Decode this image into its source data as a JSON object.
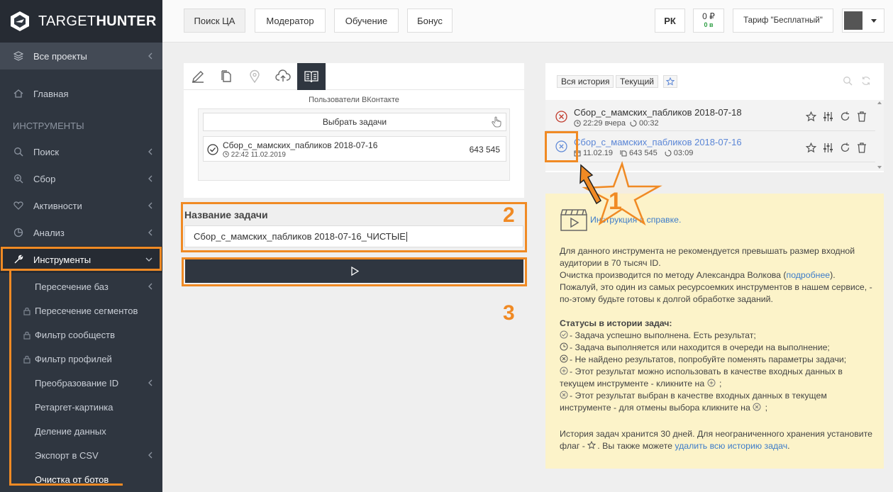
{
  "brand": {
    "name_light": "TARGET",
    "name_bold": "HUNTER"
  },
  "sidebar": {
    "all_projects": "Все проекты",
    "home": "Главная",
    "section_tools": "ИНСТРУМЕНТЫ",
    "items": [
      {
        "label": "Поиск"
      },
      {
        "label": "Сбор"
      },
      {
        "label": "Активности"
      },
      {
        "label": "Анализ"
      },
      {
        "label": "Инструменты"
      }
    ],
    "sub_items": [
      {
        "label": "Пересечение баз"
      },
      {
        "label": "Пересечение сегментов"
      },
      {
        "label": "Фильтр сообществ"
      },
      {
        "label": "Фильтр профилей"
      },
      {
        "label": "Преобразование ID"
      },
      {
        "label": "Ретаргет-картинка"
      },
      {
        "label": "Деление данных"
      },
      {
        "label": "Экспорт в CSV"
      },
      {
        "label": "Очистка от ботов"
      }
    ]
  },
  "topbar": {
    "buttons": [
      "Поиск ЦА",
      "Модератор",
      "Обучение",
      "Бонус"
    ],
    "rk": "РК",
    "balance": "0 ₽",
    "balance_sub": "0 в",
    "tariff": "Тариф \"Бесплатный\""
  },
  "tool": {
    "source_label": "Пользователи ВКонтакте",
    "choose_tasks": "Выбрать задачи",
    "selected_task": {
      "name": "Сбор_с_мамских_пабликов 2018-07-16",
      "time": "22:42 11.02.2019",
      "count": "643 545"
    },
    "name_label": "Название задачи",
    "name_value": "Сбор_с_мамских_пабликов 2018-07-16_ЧИСТЫЕ"
  },
  "history": {
    "all_history": "Вся история",
    "current": "Текущий",
    "rows": [
      {
        "name": "Сбор_с_мамских_пабликов 2018-07-18",
        "time": "22:29 вчера",
        "duration": "00:32"
      },
      {
        "name": "Сбор_с_мамских_пабликов 2018-07-16",
        "date": "11.02.19",
        "count": "643 545",
        "duration": "03:09"
      }
    ]
  },
  "help": {
    "instruction_link": "Инструкция в справке.",
    "p1a": "Для данного инструмента не рекомендуется превышать размер входной аудитории в 70 тысяч ID.",
    "p1b_pre": "Очистка производится по методу Александра Волкова (",
    "p1b_link": "подробнее",
    "p1b_post": ").",
    "p1c": "Пожалуй, это один из самых ресурсоемких инструментов в нашем сервисе, - по-этому будьте готовы к долгой обработке заданий.",
    "statuses_title": "Статусы в истории задач:",
    "s1": "- Задача успешно выполнена. Есть результат;",
    "s2": "- Задача выполняется или находится в очереди на выполнение;",
    "s3": "- Не найдено результатов, попробуйте поменять параметры задачи;",
    "s4a": "- Этот результат можно использовать в качестве входных данных в текущем инструменте - кликните на",
    "s4b": ";",
    "s5a": "- Этот результат выбран в качестве входных данных в текущем инструменте - для отмены выбора кликните на",
    "s5b": ";",
    "footer_a": "История задач хранится 30 дней. Для неограниченного хранения установите флаг -",
    "footer_b": ". Вы также можете",
    "footer_link": "удалить всю историю задач",
    "footer_c": "."
  },
  "annotations": {
    "n1": "1",
    "n2": "2",
    "n3": "3"
  },
  "colors": {
    "sidebar": "#2f3640",
    "accent_orange": "#f08a24",
    "link": "#3d7cc9",
    "help_bg": "#fcf3c9"
  }
}
